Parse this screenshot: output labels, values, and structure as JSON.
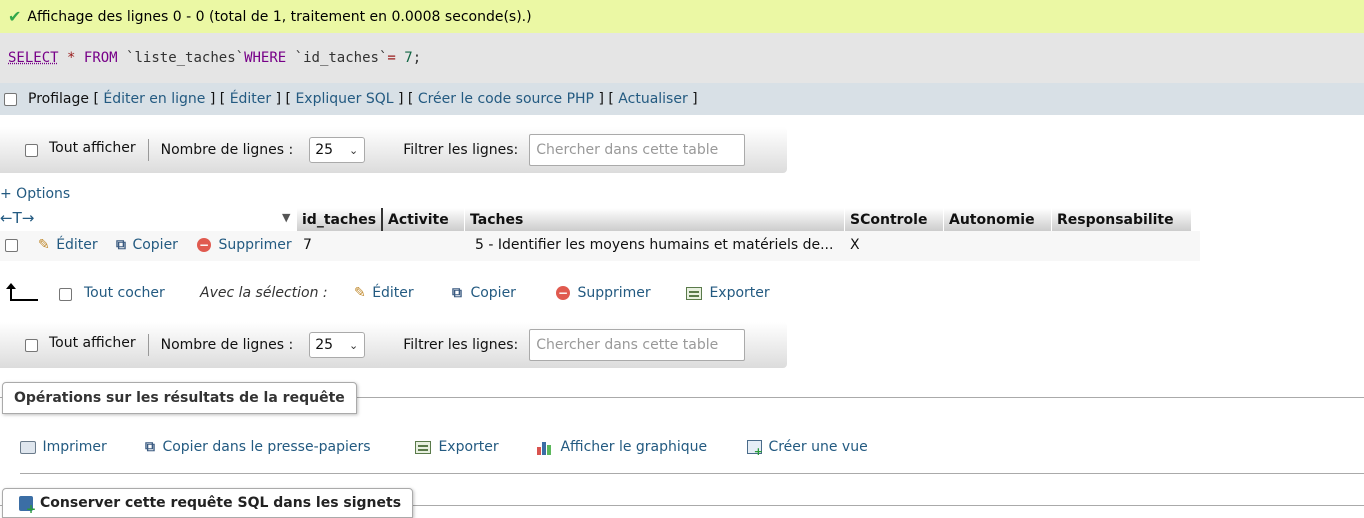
{
  "success_message": "Affichage des lignes 0 - 0 (total de 1, traitement en 0.0008 seconde(s).)",
  "sql": {
    "select": "SELECT",
    "star": "*",
    "from": "FROM",
    "table": "`liste_taches`",
    "where": "WHERE",
    "column": "`id_taches`",
    "eq": "=",
    "value": "7",
    "semicolon": ";"
  },
  "query_tools": {
    "profiling": "Profilage",
    "edit_inline": "Éditer en ligne",
    "edit": "Éditer",
    "explain": "Expliquer SQL",
    "create_php": "Créer le code source PHP",
    "refresh": "Actualiser"
  },
  "navigation": {
    "show_all": "Tout afficher",
    "rows_label": "Nombre de lignes :",
    "rows_value": "25",
    "filter_label": "Filtrer les lignes:",
    "filter_placeholder": "Chercher dans cette table"
  },
  "options_link": "+ Options",
  "table": {
    "arrows": "←T→",
    "columns": [
      "id_taches",
      "Activite",
      "Taches",
      "SControle",
      "Autonomie",
      "Responsabilite"
    ],
    "row_actions": {
      "edit": "Éditer",
      "copy": "Copier",
      "delete": "Supprimer"
    },
    "rows": [
      {
        "id_taches": "7",
        "Activite": "",
        "Taches": "5 - Identifier les moyens humains et matériels de...",
        "SControle": "X",
        "Autonomie": "",
        "Responsabilite": ""
      }
    ]
  },
  "bulk": {
    "check_all": "Tout cocher",
    "with_selection": "Avec la sélection :",
    "edit": "Éditer",
    "copy": "Copier",
    "delete": "Supprimer",
    "export": "Exporter"
  },
  "operations": {
    "legend": "Opérations sur les résultats de la requête",
    "print": "Imprimer",
    "copy_clipboard": "Copier dans le presse-papiers",
    "export": "Exporter",
    "chart": "Afficher le graphique",
    "create_view": "Créer une vue"
  },
  "bookmark": {
    "legend": "Conserver cette requête SQL dans les signets"
  }
}
